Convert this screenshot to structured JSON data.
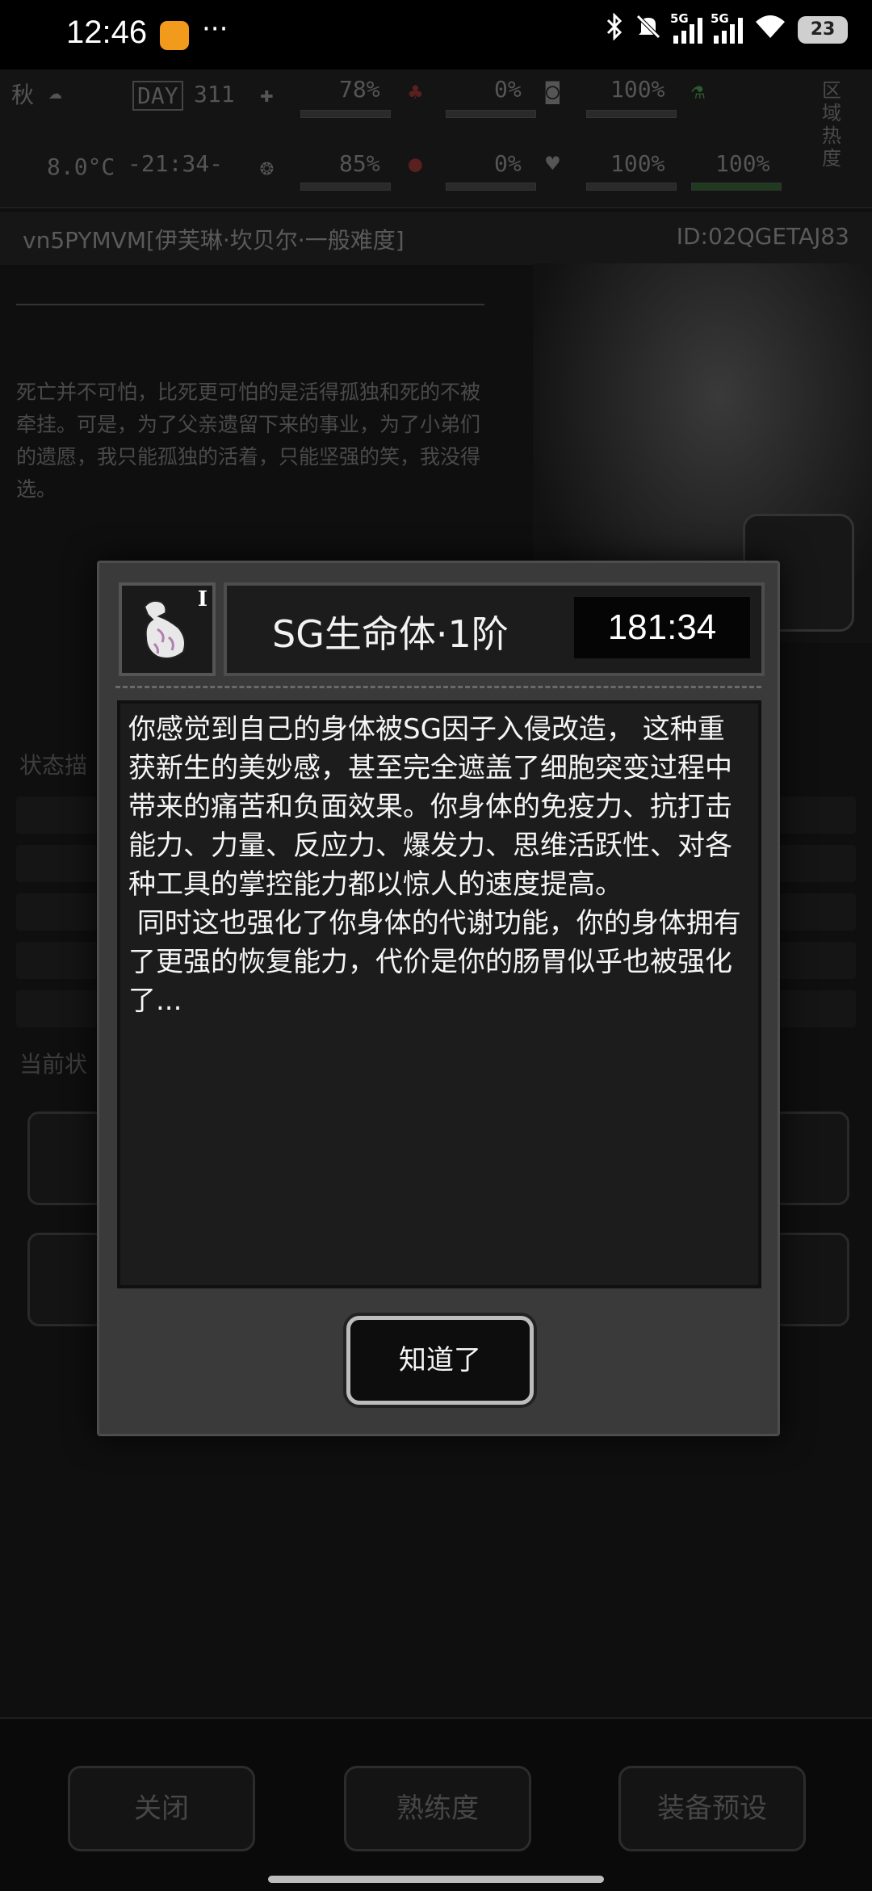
{
  "status_bar": {
    "time": "12:46",
    "more": "···",
    "signal_labels": [
      "5G",
      "5G"
    ],
    "battery": "23",
    "icons": [
      "bluetooth-icon",
      "mute-icon",
      "signal-icon",
      "wifi-icon",
      "battery-icon"
    ]
  },
  "hud": {
    "season": "秋",
    "temperature": "8.0°C",
    "day_label": "DAY",
    "day_value": "311",
    "clock": "-21:34-",
    "stat1": "78%",
    "stat2": "85%",
    "stat3": "0%",
    "stat4": "0%",
    "stat5": "100%",
    "stat6": "100%",
    "stat7": "100%",
    "region_label": "区域热度"
  },
  "character": {
    "name": "vn5PYMVM[伊芙琳·坎贝尔·一般难度]",
    "id": "ID:02QGETAJ83",
    "story": "死亡并不可怕，比死更可怕的是活得孤独和死的不被牵挂。可是，为了父亲遗留下来的事业，为了小弟们的遗愿，我只能孤独的活着，只能坚强的笑，我没得选。"
  },
  "background": {
    "section_status": "状态描",
    "section_current": "当前状"
  },
  "bottom_buttons": {
    "close": "关闭",
    "proficiency": "熟练度",
    "equip_preset": "装备预设"
  },
  "modal": {
    "icon": "flexed-arm-icon",
    "level_badge": "I",
    "title": "SG生命体·1阶",
    "timer": "181:34",
    "description": "你感觉到自己的身体被SG因子入侵改造， 这种重获新生的美妙感，甚至完全遮盖了细胞突变过程中带来的痛苦和负面效果。你身体的免疫力、抗打击能力、力量、反应力、爆发力、思维活跃性、对各种工具的掌控能力都以惊人的速度提高。\n 同时这也强化了你身体的代谢功能，你的身体拥有了更强的恢复能力，代价是你的肠胃似乎也被强化了...",
    "confirm_label": "知道了"
  }
}
